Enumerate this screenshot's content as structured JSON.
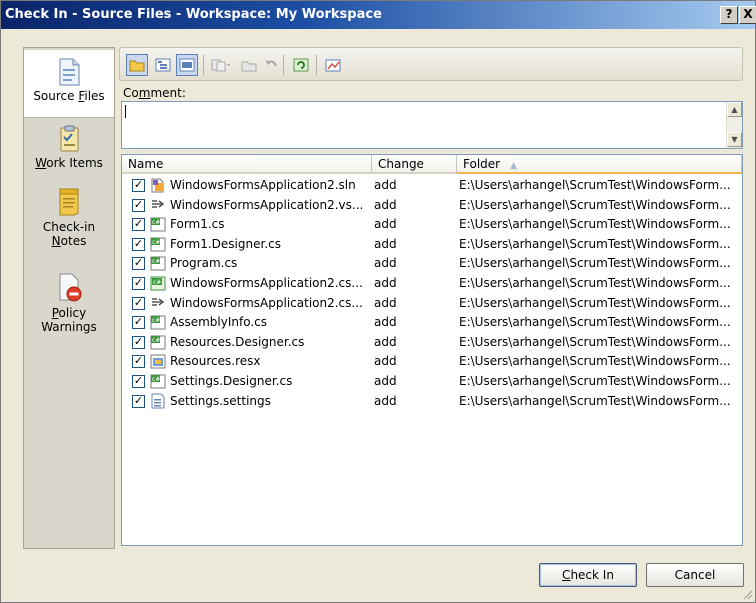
{
  "window": {
    "title": "Check In - Source Files - Workspace: My Workspace",
    "help_glyph": "?",
    "close_glyph": "X"
  },
  "sidebar": {
    "items": [
      {
        "label_pre": "Source ",
        "label_key": "F",
        "label_post": "iles",
        "icon": "source-files-icon",
        "selected": true
      },
      {
        "label_pre": "",
        "label_key": "W",
        "label_post": "ork Items",
        "icon": "work-items-icon",
        "selected": false
      },
      {
        "label_pre": "Check-in",
        "label_line2_key": "N",
        "label_line2_post": "otes",
        "icon": "checkin-notes-icon",
        "selected": false
      },
      {
        "label_pre": "",
        "label_key": "P",
        "label_post": "olicy",
        "label_line2": "Warnings",
        "icon": "policy-warnings-icon",
        "selected": false
      }
    ]
  },
  "toolbar": {
    "buttons": [
      {
        "name": "flat-view-button",
        "icon": "folder-icon",
        "active": true
      },
      {
        "name": "tree-view-button",
        "icon": "tree-view-icon",
        "active": false
      },
      {
        "name": "list-view-button",
        "icon": "list-view-icon",
        "active": true
      },
      {
        "name": "compare-button",
        "icon": "compare-icon",
        "active": false
      },
      {
        "name": "open-button",
        "icon": "open-folder-icon",
        "active": false
      },
      {
        "name": "undo-button",
        "icon": "undo-icon",
        "active": false
      },
      {
        "name": "refresh-button",
        "icon": "refresh-icon",
        "active": false
      },
      {
        "name": "shelve-button",
        "icon": "shelve-icon",
        "active": false
      }
    ]
  },
  "comment": {
    "label_pre": "Co",
    "label_key": "m",
    "label_post": "ment:",
    "value": ""
  },
  "list": {
    "columns": [
      "Name",
      "Change",
      "Folder"
    ],
    "sort_arrow": "▲",
    "rows": [
      {
        "name": "WindowsFormsApplication2.sln",
        "change": "add",
        "folder": "E:\\Users\\arhangel\\ScrumTest\\WindowsForm...",
        "icon": "solution-file-icon",
        "checked": true
      },
      {
        "name": "WindowsFormsApplication2.vs...",
        "change": "add",
        "folder": "E:\\Users\\arhangel\\ScrumTest\\WindowsForm...",
        "icon": "vs-file-icon",
        "checked": true
      },
      {
        "name": "Form1.cs",
        "change": "add",
        "folder": "E:\\Users\\arhangel\\ScrumTest\\WindowsForm...",
        "icon": "csharp-file-icon",
        "checked": true
      },
      {
        "name": "Form1.Designer.cs",
        "change": "add",
        "folder": "E:\\Users\\arhangel\\ScrumTest\\WindowsForm...",
        "icon": "csharp-file-icon",
        "checked": true
      },
      {
        "name": "Program.cs",
        "change": "add",
        "folder": "E:\\Users\\arhangel\\ScrumTest\\WindowsForm...",
        "icon": "csharp-file-icon",
        "checked": true
      },
      {
        "name": "WindowsFormsApplication2.cs...",
        "change": "add",
        "folder": "E:\\Users\\arhangel\\ScrumTest\\WindowsForm...",
        "icon": "csproj-file-icon",
        "checked": true
      },
      {
        "name": "WindowsFormsApplication2.cs...",
        "change": "add",
        "folder": "E:\\Users\\arhangel\\ScrumTest\\WindowsForm...",
        "icon": "vs-file-icon",
        "checked": true
      },
      {
        "name": "AssemblyInfo.cs",
        "change": "add",
        "folder": "E:\\Users\\arhangel\\ScrumTest\\WindowsForm...",
        "icon": "csharp-file-icon",
        "checked": true
      },
      {
        "name": "Resources.Designer.cs",
        "change": "add",
        "folder": "E:\\Users\\arhangel\\ScrumTest\\WindowsForm...",
        "icon": "csharp-file-icon",
        "checked": true
      },
      {
        "name": "Resources.resx",
        "change": "add",
        "folder": "E:\\Users\\arhangel\\ScrumTest\\WindowsForm...",
        "icon": "resx-file-icon",
        "checked": true
      },
      {
        "name": "Settings.Designer.cs",
        "change": "add",
        "folder": "E:\\Users\\arhangel\\ScrumTest\\WindowsForm...",
        "icon": "csharp-file-icon",
        "checked": true
      },
      {
        "name": "Settings.settings",
        "change": "add",
        "folder": "E:\\Users\\arhangel\\ScrumTest\\WindowsForm...",
        "icon": "settings-file-icon",
        "checked": true
      }
    ]
  },
  "buttons": {
    "checkin_key": "C",
    "checkin_post": "heck In",
    "cancel": "Cancel"
  },
  "colors": {
    "titlebar_start": "#0a246a",
    "titlebar_end": "#a6caf0",
    "dialog_bg": "#ece9d8"
  }
}
